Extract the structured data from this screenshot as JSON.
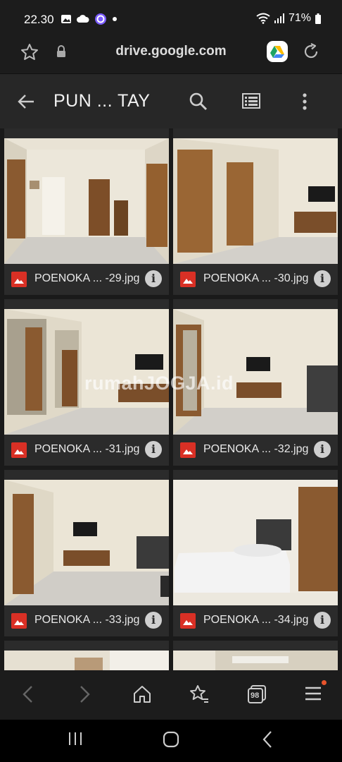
{
  "status_bar": {
    "time": "22.30",
    "battery": "71%"
  },
  "browser": {
    "url": "drive.google.com",
    "tab_count": "98"
  },
  "app_bar": {
    "title": "PUN ... TAY"
  },
  "files": [
    {
      "name": "POENOKA ... -29.jpg"
    },
    {
      "name": "POENOKA ... -30.jpg"
    },
    {
      "name": "POENOKA ... -31.jpg"
    },
    {
      "name": "POENOKA ... -32.jpg"
    },
    {
      "name": "POENOKA ... -33.jpg"
    },
    {
      "name": "POENOKA ... -34.jpg"
    }
  ],
  "watermark": "rumahJOGJA.id",
  "colors": {
    "image_file_icon": "#d93025",
    "notification_dot": "#e8542c"
  }
}
